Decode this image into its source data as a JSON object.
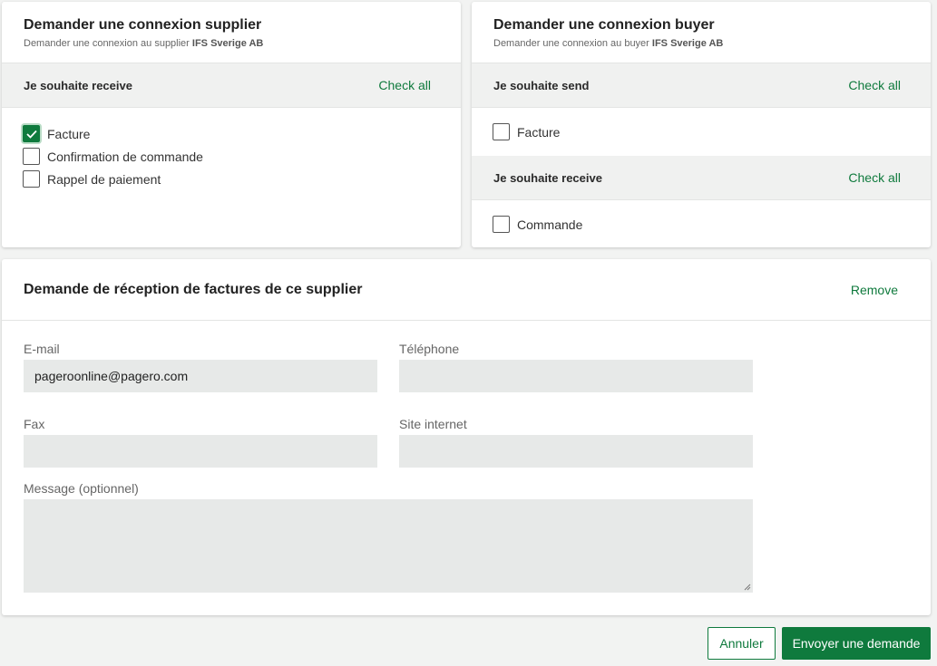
{
  "supplier_card": {
    "title": "Demander une connexion supplier",
    "subtitle_prefix": "Demander une connexion au supplier ",
    "subtitle_company": "IFS Sverige AB",
    "section_label": "Je souhaite receive",
    "check_all": "Check all",
    "items": [
      {
        "label": "Facture",
        "checked": true
      },
      {
        "label": "Confirmation de commande",
        "checked": false
      },
      {
        "label": "Rappel de paiement",
        "checked": false
      }
    ]
  },
  "buyer_card": {
    "title": "Demander une connexion buyer",
    "subtitle_prefix": "Demander une connexion au buyer ",
    "subtitle_company": "IFS Sverige AB",
    "send_section_label": "Je souhaite send",
    "send_check_all": "Check all",
    "send_items": [
      {
        "label": "Facture",
        "checked": false
      }
    ],
    "receive_section_label": "Je souhaite receive",
    "receive_check_all": "Check all",
    "receive_items": [
      {
        "label": "Commande",
        "checked": false
      }
    ]
  },
  "request_card": {
    "title": "Demande de réception de factures de ce supplier",
    "remove_label": "Remove",
    "email_label": "E-mail",
    "email_value": "pageroonline@pagero.com",
    "phone_label": "Téléphone",
    "phone_value": "",
    "fax_label": "Fax",
    "fax_value": "",
    "website_label": "Site internet",
    "website_value": "",
    "message_label": "Message (optionnel)",
    "message_value": ""
  },
  "actions": {
    "cancel_label": "Annuler",
    "send_label": "Envoyer une demande"
  },
  "colors": {
    "accent": "#0f7a3d",
    "page_bg": "#f2f3f2",
    "input_bg": "#e7e9e8"
  }
}
